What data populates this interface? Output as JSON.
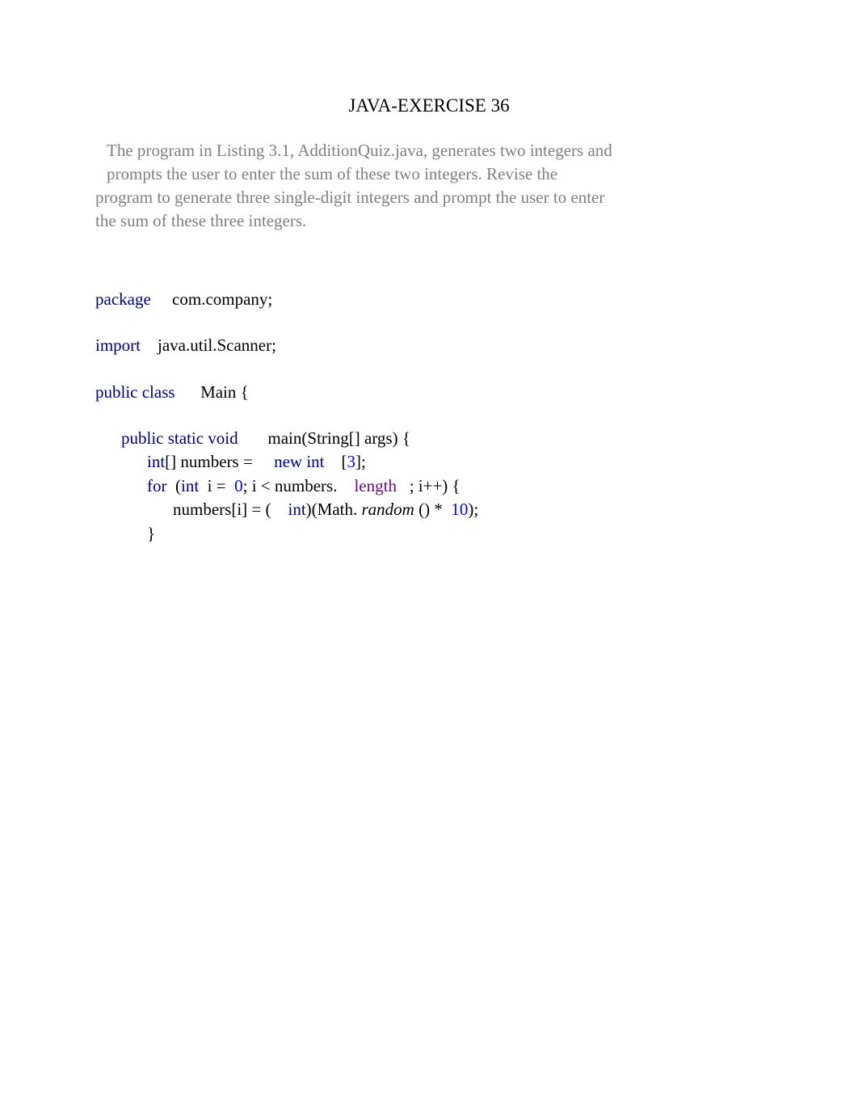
{
  "title": "JAVA-EXERCISE 36",
  "description": {
    "line1": "The program in Listing 3.1, AdditionQuiz.java, generates two integers and",
    "line2": "prompts the user to enter the sum of these two integers. Revise the",
    "line3": "program to generate three single-digit integers and prompt the user to enter",
    "line4": "the sum of these three integers."
  },
  "code": {
    "package_kw": "package ",
    "package_name": "com.company;",
    "import_kw": "import ",
    "import_name": "java.util.Scanner;",
    "class_kw": "public class ",
    "class_name": "Main {",
    "method_kw": "public static void ",
    "method_sig": "main(String[] args) {",
    "int_kw": "int",
    "arr_decl": "[] numbers = ",
    "new_int_kw": "new int",
    "bracket_open": "[",
    "arr_size": "3",
    "arr_end": "];",
    "for_kw": "for ",
    "paren_open": "(",
    "for_var": " i = ",
    "zero": "0",
    "for_cond": "; i < numbers.",
    "length_field": "length",
    "for_inc": "; i++) {",
    "body_assign": "numbers[i] = (",
    "cast_int": "int",
    "math_part": ")(Math.",
    "random_ident": "random",
    "paren_star": "() * ",
    "ten": "10",
    "body_end": ");",
    "close_brace": "}"
  }
}
